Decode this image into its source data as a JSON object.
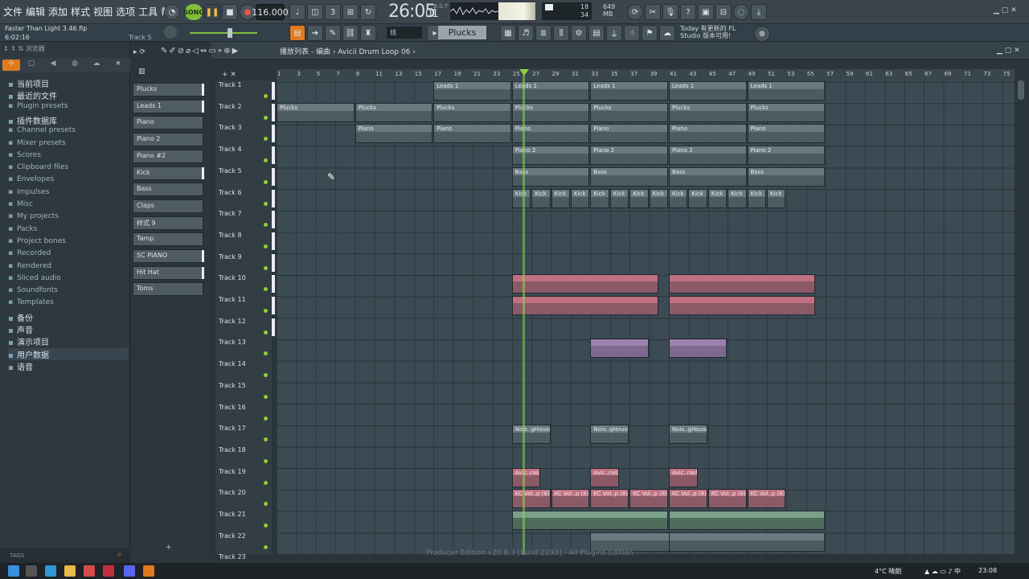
{
  "menu": [
    "文件",
    "编辑",
    "添加",
    "样式",
    "视图",
    "选项",
    "工具",
    "帮助"
  ],
  "transport": {
    "song_label": "SONG",
    "tempo": "116.000",
    "time_main": "26:05",
    "time_sub": "01",
    "time_unit": "B:S:T"
  },
  "meters": {
    "cpu": "18",
    "ram": "649 MB",
    "voices": "34"
  },
  "project": {
    "file": "Faster Than Light 3.46.flp",
    "time": "6:02:16",
    "hint": "Track 5"
  },
  "pattern_selector": "Plucks",
  "news": {
    "line1": "Today  有更新的 FL",
    "line2": "Studio 版本可用!"
  },
  "browser": {
    "title": "浏览器",
    "items": [
      {
        "label": "当前项目",
        "big": true
      },
      {
        "label": "最近的文件",
        "big": true
      },
      {
        "label": "Plugin presets",
        "big": false
      },
      {
        "label": "插件数据库",
        "big": true
      },
      {
        "label": "Channel presets",
        "big": false
      },
      {
        "label": "Mixer presets",
        "big": false
      },
      {
        "label": "Scores",
        "big": false
      },
      {
        "label": "Clipboard files",
        "big": false
      },
      {
        "label": "Envelopes",
        "big": false
      },
      {
        "label": "Impulses",
        "big": false
      },
      {
        "label": "Misc",
        "big": false
      },
      {
        "label": "My projects",
        "big": false
      },
      {
        "label": "Packs",
        "big": false
      },
      {
        "label": "Project bones",
        "big": false
      },
      {
        "label": "Recorded",
        "big": false
      },
      {
        "label": "Rendered",
        "big": false
      },
      {
        "label": "Sliced audio",
        "big": false
      },
      {
        "label": "Soundfonts",
        "big": false
      },
      {
        "label": "Templates",
        "big": false
      },
      {
        "label": "备份",
        "big": true
      },
      {
        "label": "声音",
        "big": true
      },
      {
        "label": "演示项目",
        "big": true
      },
      {
        "label": "用户数据",
        "big": true
      },
      {
        "label": "语音",
        "big": true
      }
    ],
    "tags": "TAGS"
  },
  "channels": [
    "Plucks",
    "Leads 1",
    "Piano",
    "Piano 2",
    "Piano #2",
    "Kick",
    "Bass",
    "Claps",
    "样式 9",
    "Tamp",
    "SC PIANO",
    "Hit Hat",
    "Toms"
  ],
  "playlist": {
    "title": "播放列表 - 编曲 › Avicii Drum Loop 06 ›"
  },
  "ruler": [
    "1",
    "3",
    "5",
    "7",
    "9",
    "11",
    "13",
    "15",
    "17",
    "19",
    "21",
    "23",
    "25",
    "27",
    "29",
    "31",
    "33",
    "35",
    "37",
    "39",
    "41",
    "43",
    "45",
    "47",
    "49",
    "51",
    "53",
    "55",
    "57",
    "59",
    "61",
    "63",
    "65",
    "67",
    "69",
    "71",
    "73",
    "75"
  ],
  "tracks": [
    "Track 1",
    "Track 2",
    "Track 3",
    "Track 4",
    "Track 5",
    "Track 6",
    "Track 7",
    "Track 8",
    "Track 9",
    "Track 10",
    "Track 11",
    "Track 12",
    "Track 13",
    "Track 14",
    "Track 15",
    "Track 16",
    "Track 17",
    "Track 18",
    "Track 19",
    "Track 20",
    "Track 21",
    "Track 22",
    "Track 23"
  ],
  "clips": [
    {
      "t": 0,
      "label": "Leads 1",
      "starts": [
        17,
        25,
        33,
        41,
        49
      ],
      "len": 8,
      "color": "gray"
    },
    {
      "t": 1,
      "label": "Plucks",
      "starts": [
        1,
        9,
        17,
        25,
        33,
        41,
        49
      ],
      "len": 8,
      "color": "gray"
    },
    {
      "t": 2,
      "label": "Piano",
      "starts": [
        9,
        17,
        25,
        33,
        41,
        49
      ],
      "len": 8,
      "color": "gray"
    },
    {
      "t": 3,
      "label": "Piano 2",
      "starts": [
        25,
        33,
        41,
        49
      ],
      "len": 8,
      "color": "gray"
    },
    {
      "t": 4,
      "label": "Bass",
      "starts": [
        25,
        33,
        41,
        49
      ],
      "len": 8,
      "color": "gray"
    },
    {
      "t": 5,
      "label": "Kick",
      "starts": [
        25,
        27,
        29,
        31,
        33,
        35,
        37,
        39,
        41,
        43,
        45,
        47,
        49,
        51
      ],
      "len": 2,
      "color": "gray"
    },
    {
      "t": 9,
      "label": "",
      "starts": [
        25,
        41
      ],
      "len": 15,
      "color": "pink"
    },
    {
      "t": 10,
      "label": "",
      "starts": [
        25,
        41
      ],
      "len": 15,
      "color": "pink"
    },
    {
      "t": 12,
      "label": "",
      "starts": [
        33,
        41
      ],
      "len": 6,
      "color": "purple"
    },
    {
      "t": 16,
      "label": "Nois..gHouse",
      "starts": [
        25,
        33,
        41
      ],
      "len": 4,
      "color": "gray"
    },
    {
      "t": 18,
      "label": "Avic..rash",
      "starts": [
        25,
        33,
        41
      ],
      "len": 3,
      "color": "pink"
    },
    {
      "t": 19,
      "label": "KC Vol..p (8)",
      "starts": [
        25,
        29,
        33,
        37,
        41,
        45,
        49
      ],
      "len": 4,
      "color": "pink"
    },
    {
      "t": 20,
      "label": "",
      "starts": [
        25,
        41
      ],
      "len": 16,
      "color": "green"
    },
    {
      "t": 21,
      "label": "",
      "starts": [
        33,
        41
      ],
      "len": 16,
      "color": "gray"
    }
  ],
  "taskbar": {
    "weather": "4°C  晴朗",
    "clock": "23:08"
  },
  "watermark": "Producer Edition v20.8.3 [build 2293] - All Plugins Edition"
}
